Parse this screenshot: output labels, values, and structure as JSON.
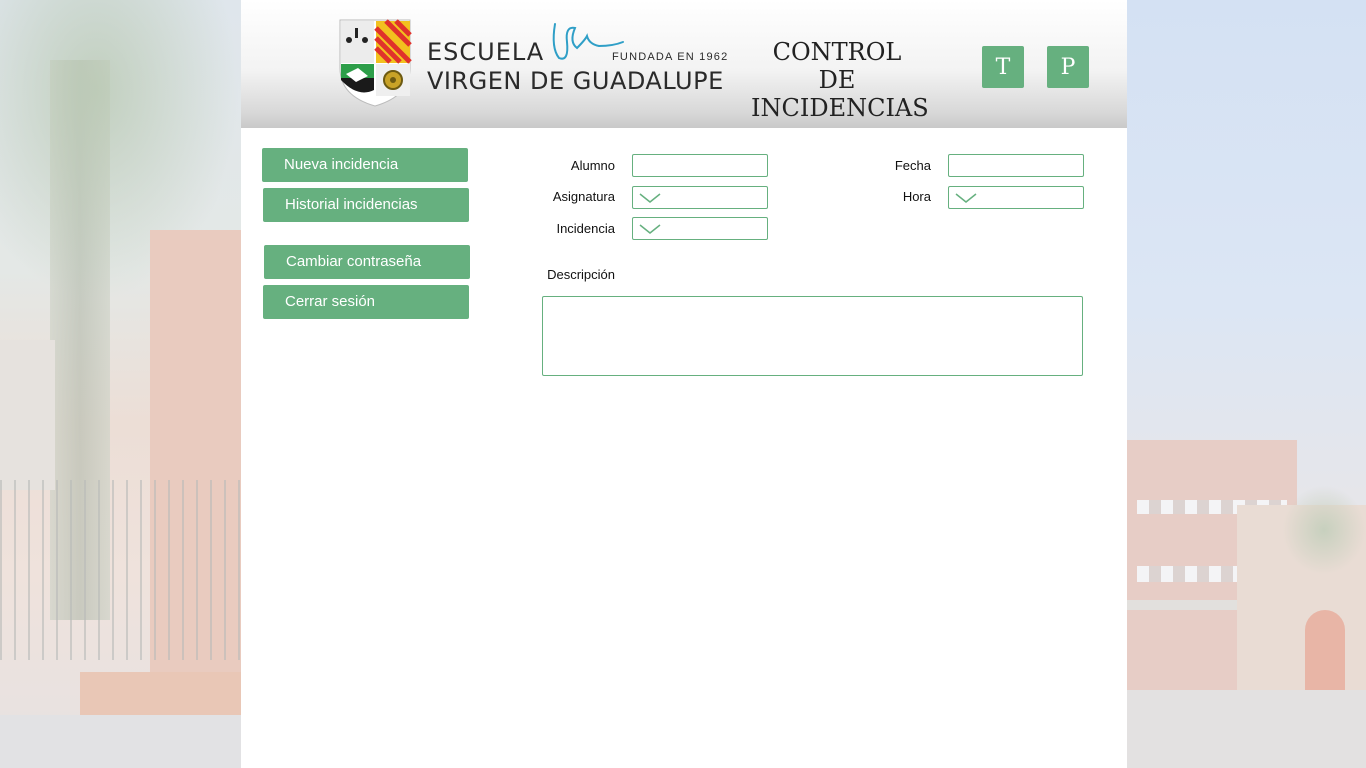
{
  "header": {
    "school_line1": "ESCUELA",
    "school_line2": "VIRGEN DE GUADALUPE",
    "founded": "FUNDADA EN 1962",
    "app_title": "CONTROL DE INCIDENCIAS",
    "buttons": [
      {
        "label": "T"
      },
      {
        "label": "P"
      }
    ]
  },
  "menu": {
    "items": [
      {
        "label": "Nueva incidencia"
      },
      {
        "label": "Historial incidencias"
      },
      {
        "label": "Cambiar contraseña"
      },
      {
        "label": "Cerrar sesión"
      }
    ]
  },
  "form": {
    "alumno": {
      "label": "Alumno",
      "value": ""
    },
    "fecha": {
      "label": "Fecha",
      "value": ""
    },
    "asignatura": {
      "label": "Asignatura",
      "value": ""
    },
    "hora": {
      "label": "Hora",
      "value": ""
    },
    "incidencia": {
      "label": "Incidencia",
      "value": ""
    },
    "descripcion": {
      "label": "Descripción",
      "value": ""
    }
  },
  "colors": {
    "accent": "#66b07f",
    "header_gradient_end": "#c9c9c9"
  },
  "icons": {
    "dropdown": "chevron-down-icon"
  }
}
